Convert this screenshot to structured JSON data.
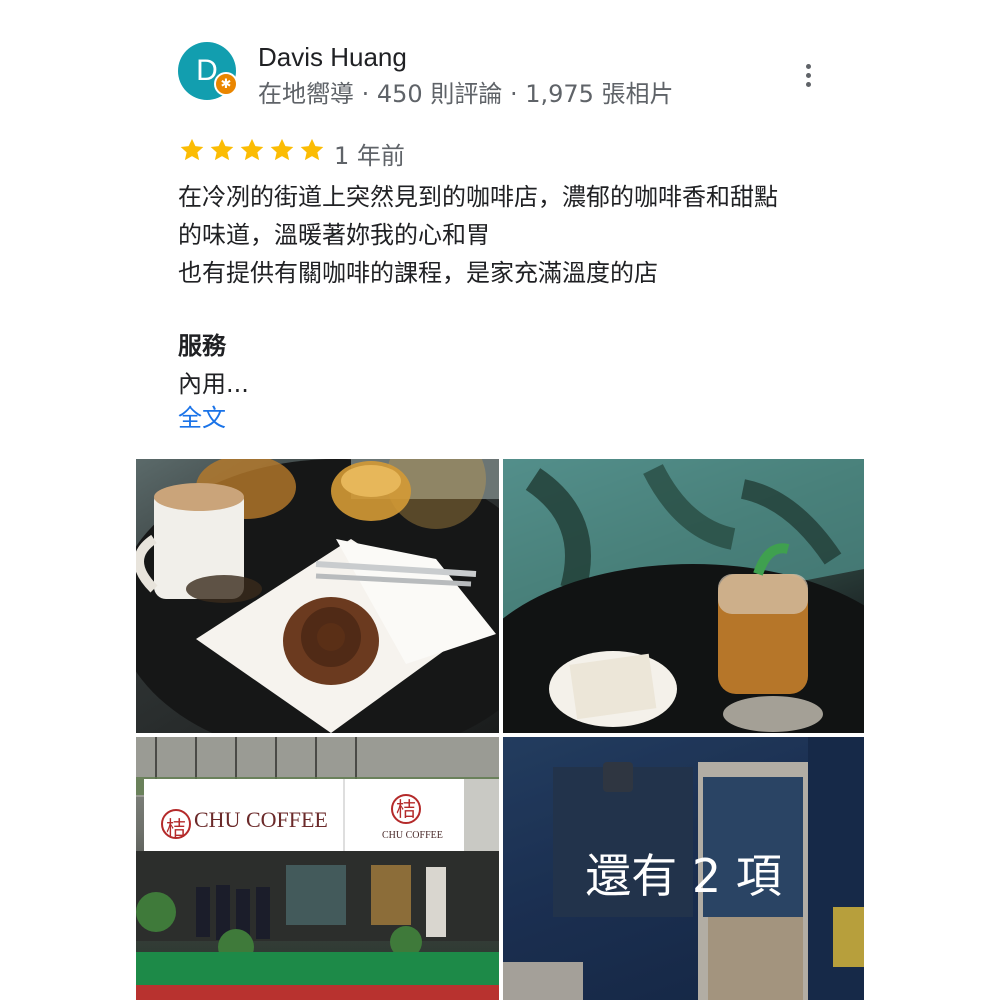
{
  "reviewer": {
    "avatar_letter": "D",
    "avatar_color": "#129eaf",
    "badge_icon": "local-guide-star-icon",
    "name": "Davis Huang",
    "meta": "在地嚮導 · 450 則評論 · 1,975 張相片"
  },
  "more_options_icon": "more-vert-icon",
  "rating": {
    "stars": 5,
    "star_color": "#fbbc04",
    "time": "1 年前"
  },
  "review": {
    "lines": [
      "在冷冽的街道上突然見到的咖啡店，濃郁的咖啡香和甜點",
      "的味道，溫暖著妳我的心和胃",
      "也有提供有關咖啡的課程，是家充滿溫度的店"
    ],
    "section_title": "服務",
    "section_value": "內用...",
    "full_text_link": "全文",
    "link_color": "#1a73e8"
  },
  "photos": {
    "storefront_sign": {
      "logo_char": "桔",
      "name": "CHU COFFEE",
      "name_small": "CHU COFFEE"
    },
    "more_overlay": "還有 2 項"
  }
}
